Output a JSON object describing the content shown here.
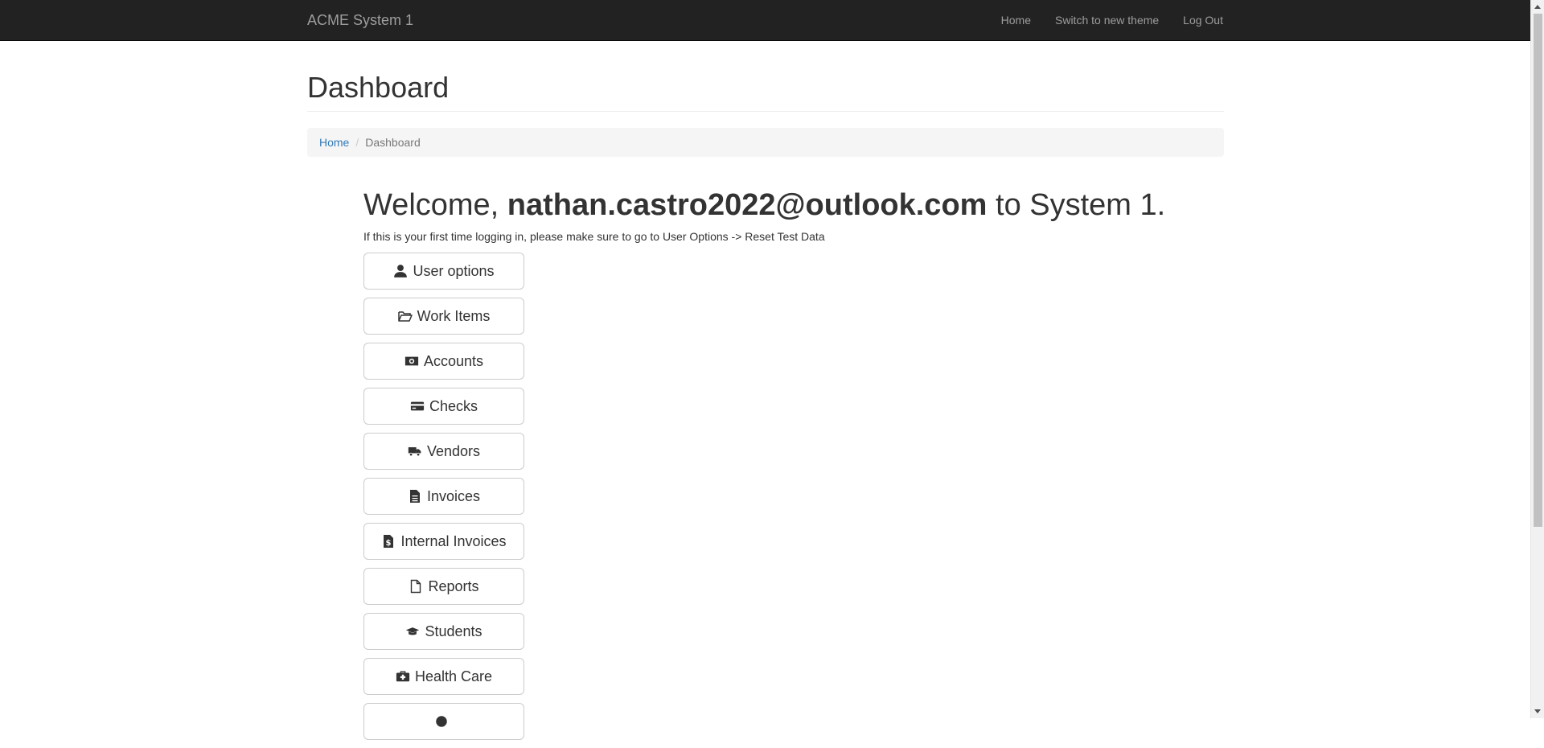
{
  "navbar": {
    "brand": "ACME System 1",
    "links": [
      "Home",
      "Switch to new theme",
      "Log Out"
    ]
  },
  "page": {
    "title": "Dashboard"
  },
  "breadcrumb": {
    "home": "Home",
    "current": "Dashboard"
  },
  "welcome": {
    "prefix": "Welcome, ",
    "user": "nathan.castro2022@outlook.com",
    "suffix": " to System 1.",
    "hint": "If this is your first time logging in, please make sure to go to User Options -> Reset Test Data"
  },
  "menu": [
    {
      "label": "User options",
      "icon": "user-icon"
    },
    {
      "label": "Work Items",
      "icon": "folder-open-icon"
    },
    {
      "label": "Accounts",
      "icon": "money-icon"
    },
    {
      "label": "Checks",
      "icon": "credit-card-icon"
    },
    {
      "label": "Vendors",
      "icon": "truck-icon"
    },
    {
      "label": "Invoices",
      "icon": "file-text-icon"
    },
    {
      "label": "Internal Invoices",
      "icon": "file-invoice-dollar-icon"
    },
    {
      "label": "Reports",
      "icon": "file-icon"
    },
    {
      "label": "Students",
      "icon": "graduation-cap-icon"
    },
    {
      "label": "Health Care",
      "icon": "medkit-icon"
    },
    {
      "label": "",
      "icon": "partial-icon"
    }
  ]
}
